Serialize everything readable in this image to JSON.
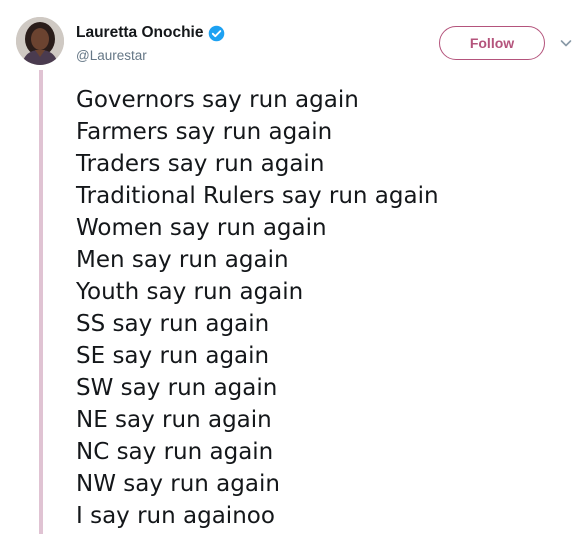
{
  "author": {
    "display_name": "Lauretta Onochie",
    "username": "@Laurestar",
    "verified": true,
    "avatar_icon": "user-avatar-photo"
  },
  "actions": {
    "follow_label": "Follow",
    "more_icon": "chevron-down-icon"
  },
  "tweet": {
    "lines": [
      "Governors say run again",
      "Farmers say run again",
      "Traders say run again",
      "Traditional Rulers say run again",
      "Women say run again",
      "Men say run again",
      "Youth say run again",
      "SS say run again",
      "SE say run again",
      "SW say run again",
      "NE say run again",
      "NC say run again",
      "NW say run again",
      "I say run againoo"
    ]
  },
  "colors": {
    "accent": "#b4547c",
    "thread_line": "#e0c3d3",
    "verified_badge": "#1da1f2",
    "text_primary": "#14171a",
    "text_secondary": "#657786"
  }
}
